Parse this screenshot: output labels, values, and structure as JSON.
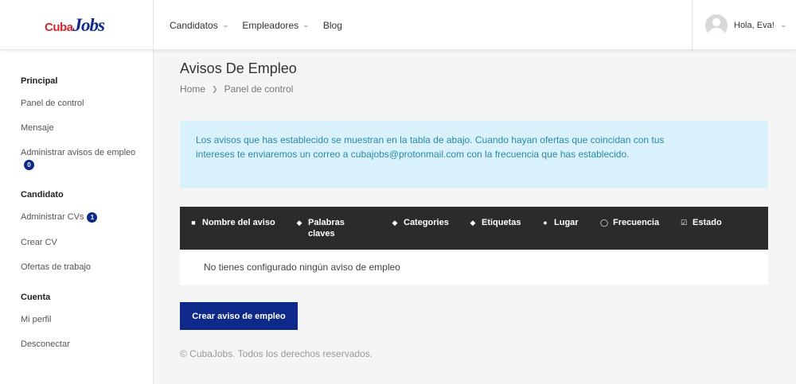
{
  "logo": {
    "part1": "Cuba",
    "part2": "Jobs"
  },
  "nav": [
    {
      "label": "Candidatos",
      "has_dropdown": true
    },
    {
      "label": "Empleadores",
      "has_dropdown": true
    },
    {
      "label": "Blog",
      "has_dropdown": false
    }
  ],
  "user": {
    "greeting": "Hola, Eva!"
  },
  "sidebar": {
    "sections": [
      {
        "title": "Principal",
        "items": [
          {
            "label": "Panel de control"
          },
          {
            "label": "Mensaje"
          },
          {
            "label": "Administrar avisos de empleo",
            "badge": "0"
          }
        ]
      },
      {
        "title": "Candidato",
        "items": [
          {
            "label": "Administrar CVs",
            "badge": "1"
          },
          {
            "label": "Crear CV"
          },
          {
            "label": "Ofertas de trabajo"
          }
        ]
      },
      {
        "title": "Cuenta",
        "items": [
          {
            "label": "Mi perfil"
          },
          {
            "label": "Desconectar"
          }
        ]
      }
    ]
  },
  "main": {
    "title": "Avisos De Empleo",
    "breadcrumb": {
      "home": "Home",
      "current": "Panel de control"
    },
    "info_text": "Los avisos que has establecido se muestran en la tabla de abajo. Cuando hayan ofertas que coincidan con tus intereses te enviaremos un correo a cubajobs@protonmail.com con la frecuencia que has establecido.",
    "table": {
      "columns": [
        {
          "label": "Nombre del aviso",
          "icon": "document-icon"
        },
        {
          "label": "Palabras claves",
          "icon": "tag-icon"
        },
        {
          "label": "Categories",
          "icon": "tags-icon"
        },
        {
          "label": "Etiquetas",
          "icon": "tag-icon"
        },
        {
          "label": "Lugar",
          "icon": "map-pin-icon"
        },
        {
          "label": "Frecuencia",
          "icon": "clock-icon"
        },
        {
          "label": "Estado",
          "icon": "checkbox-icon"
        }
      ],
      "empty_text": "No tienes configurado ningún aviso de empleo"
    },
    "create_button": "Crear aviso de empleo",
    "footer": "© CubaJobs. Todos los derechos reservados."
  },
  "colors": {
    "primary": "#0d2a8a",
    "logo_red": "#d7262d",
    "info_bg": "#d8f1fb",
    "info_text": "#2b8aa6",
    "table_head": "#2b2b2b"
  }
}
